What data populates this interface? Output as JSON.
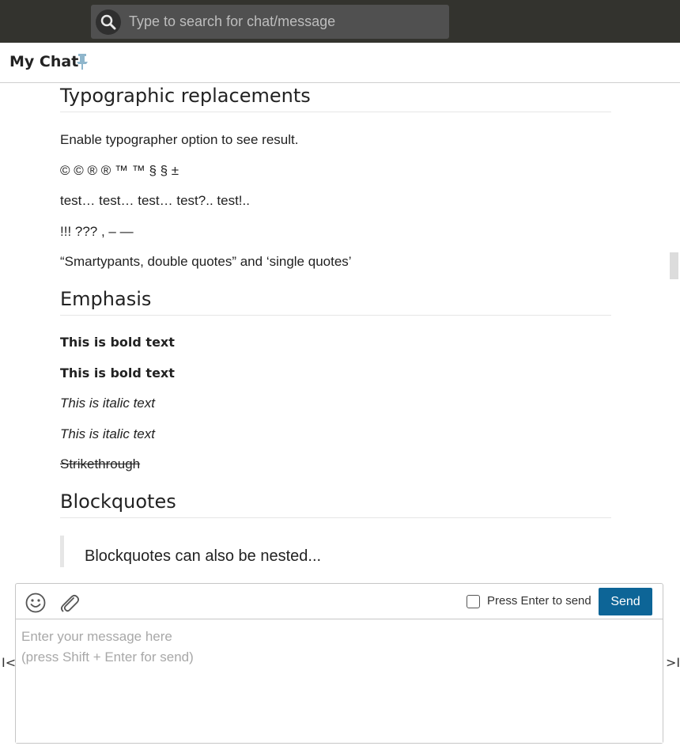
{
  "search": {
    "placeholder": "Type to search for chat/message"
  },
  "header": {
    "title": "My Chat",
    "pin_icon": "pin-icon"
  },
  "article": {
    "sections": [
      {
        "heading": "Typographic replacements",
        "paragraphs": [
          "Enable typographer option to see result.",
          "© © ® ® ™ ™ § § ±",
          "test… test… test… test?.. test!..",
          "!!! ??? , – —",
          "“Smartypants, double quotes” and ‘single quotes’"
        ]
      },
      {
        "heading": "Emphasis",
        "bold_1": "This is bold text",
        "bold_2": "This is bold text",
        "italic_1": "This is italic text",
        "italic_2": "This is italic text",
        "strike": "Strikethrough"
      },
      {
        "heading": "Blockquotes",
        "quote": "Blockquotes can also be nested..."
      }
    ]
  },
  "composer": {
    "press_enter_label": "Press Enter to send",
    "press_enter_checked": false,
    "send_label": "Send",
    "message_placeholder": "Enter your message here\n(press Shift + Enter for send)",
    "send_color": "#0d6597"
  },
  "nav": {
    "left_glyph": "I<",
    "right_glyph": ">I"
  }
}
